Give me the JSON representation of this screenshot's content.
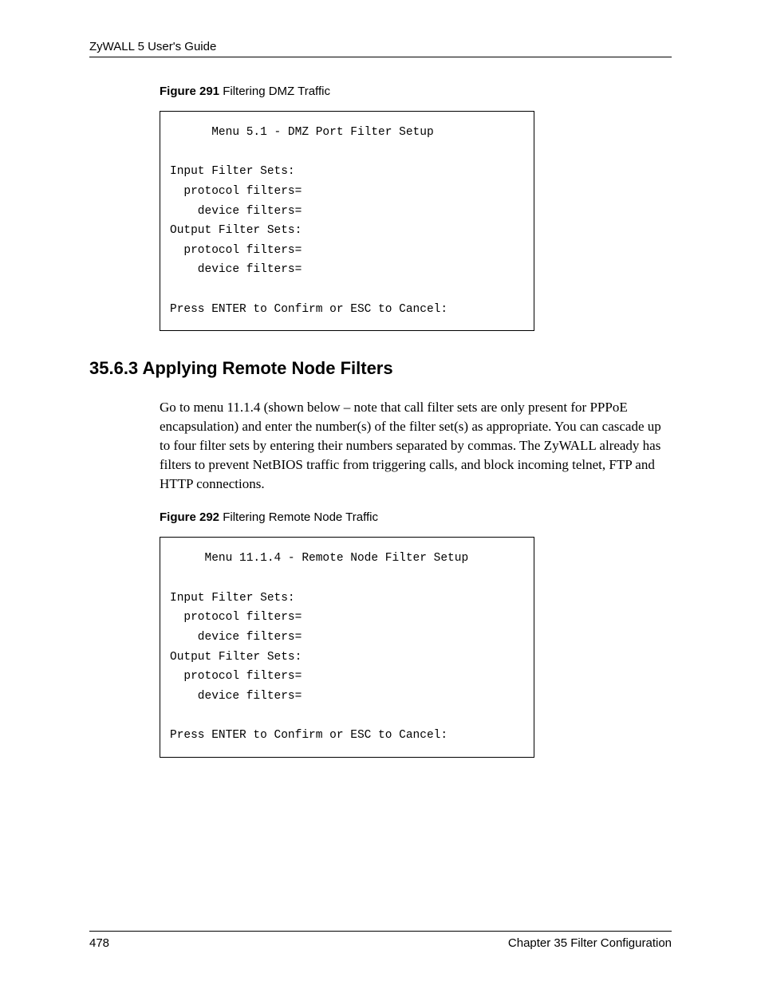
{
  "header": {
    "runningTitle": "ZyWALL 5 User's Guide"
  },
  "figure291": {
    "labelBold": "Figure 291   ",
    "labelRest": "Filtering DMZ Traffic",
    "terminal": "      Menu 5.1 - DMZ Port Filter Setup\n\nInput Filter Sets:\n  protocol filters=\n    device filters=\nOutput Filter Sets:\n  protocol filters=\n    device filters=\n\nPress ENTER to Confirm or ESC to Cancel:"
  },
  "section": {
    "heading": "35.6.3  Applying Remote Node Filters",
    "paragraph": "Go to menu 11.1.4 (shown below – note that call filter sets are only present for PPPoE encapsulation) and enter the number(s) of the filter set(s) as appropriate. You can cascade up to four filter sets by entering their numbers separated by commas. The ZyWALL already has filters to prevent NetBIOS traffic from triggering calls, and block incoming telnet, FTP and HTTP connections."
  },
  "figure292": {
    "labelBold": "Figure 292   ",
    "labelRest": "Filtering Remote Node Traffic",
    "terminal": "     Menu 11.1.4 - Remote Node Filter Setup\n\nInput Filter Sets:\n  protocol filters=\n    device filters=\nOutput Filter Sets:\n  protocol filters=\n    device filters=\n\nPress ENTER to Confirm or ESC to Cancel:"
  },
  "footer": {
    "pageNumber": "478",
    "chapter": "Chapter 35 Filter Configuration"
  }
}
